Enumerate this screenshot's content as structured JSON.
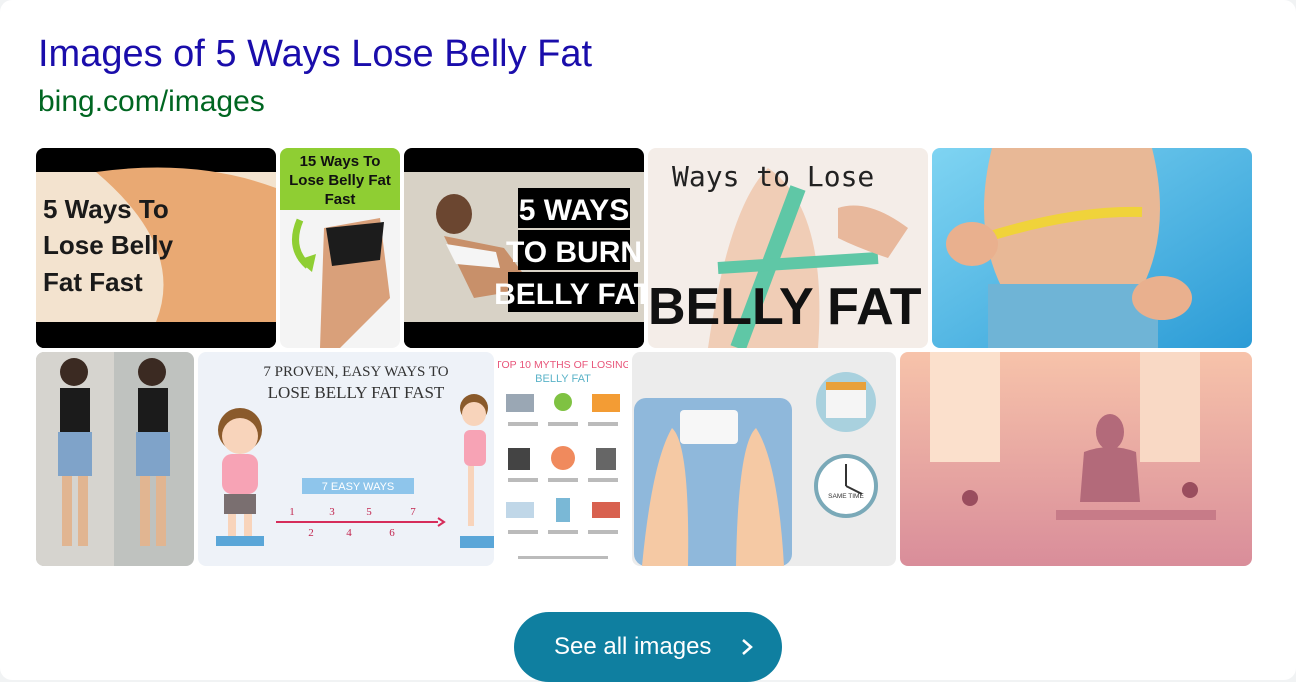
{
  "result": {
    "title": "Images of 5 Ways Lose Belly Fat",
    "source": "bing.com/images"
  },
  "images": {
    "img1": {
      "lines": [
        "5 Ways To",
        "Lose Belly",
        "Fat Fast"
      ]
    },
    "img2": {
      "lines": [
        "15 Ways To",
        "Lose Belly Fat",
        "Fast"
      ]
    },
    "img3": {
      "lines": [
        "5 WAYS",
        "TO BURN",
        "BELLY FAT"
      ]
    },
    "img4": {
      "top": "Ways to Lose",
      "bottom": "BELLY FAT"
    },
    "img7": {
      "title1": "7 PROVEN, EASY WAYS TO",
      "title2": "LOSE BELLY FAT FAST",
      "ribbon": "7 EASY WAYS",
      "nums": [
        "1",
        "2",
        "3",
        "4",
        "5",
        "6",
        "7"
      ]
    },
    "img8": {
      "title1": "TOP 10 MYTHS OF LOSING",
      "title2": "BELLY FAT"
    },
    "img9": {
      "clock_label": "SAME TIME"
    }
  },
  "see_all": {
    "label": "See all images"
  },
  "colors": {
    "title": "#1a0dab",
    "url": "#006621",
    "button": "#0f7fa0"
  }
}
